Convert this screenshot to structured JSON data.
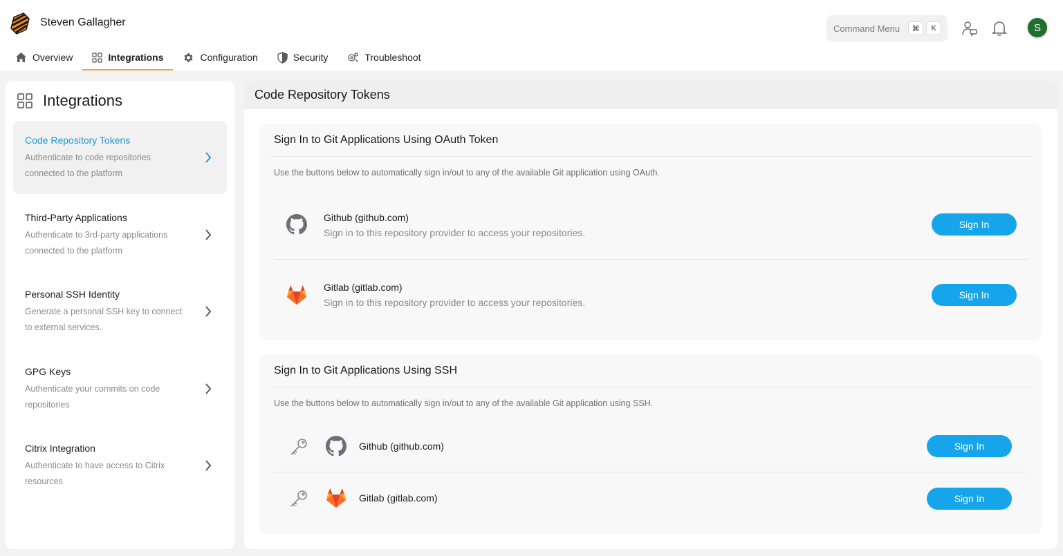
{
  "header": {
    "user_name": "Steven Gallagher",
    "command_menu": {
      "label": "Command Menu",
      "key1": "⌘",
      "key2": "K"
    },
    "avatar_initial": "S",
    "avatar_color": "#1f6f2e"
  },
  "tabs": [
    {
      "label": "Overview",
      "icon": "home-icon",
      "active": false
    },
    {
      "label": "Integrations",
      "icon": "grid-icon",
      "active": true
    },
    {
      "label": "Configuration",
      "icon": "gear-icon",
      "active": false
    },
    {
      "label": "Security",
      "icon": "shield-icon",
      "active": false
    },
    {
      "label": "Troubleshoot",
      "icon": "troubleshoot-icon",
      "active": false
    }
  ],
  "sidebar": {
    "title": "Integrations",
    "items": [
      {
        "title": "Code Repository Tokens",
        "desc": "Authenticate to code repositories connected to the platform",
        "active": true
      },
      {
        "title": "Third-Party Applications",
        "desc": "Authenticate to 3rd-party applications connected to the platform",
        "active": false
      },
      {
        "title": "Personal SSH Identity",
        "desc": "Generate a personal SSH key to connect to external services.",
        "active": false
      },
      {
        "title": "GPG Keys",
        "desc": "Authenticate your commits on code repositories",
        "active": false
      },
      {
        "title": "Citrix Integration",
        "desc": "Authenticate to have access to Citrix resources",
        "active": false
      }
    ]
  },
  "main": {
    "title": "Code Repository Tokens",
    "oauth": {
      "title": "Sign In to Git Applications Using OAuth Token",
      "desc": "Use the buttons below to automatically sign in/out to any of the available Git application using OAuth.",
      "providers": [
        {
          "name": "Github (github.com)",
          "desc": "Sign in to this repository provider to access your repositories.",
          "icon": "github-icon",
          "button": "Sign In"
        },
        {
          "name": "Gitlab (gitlab.com)",
          "desc": "Sign in to this repository provider to access your repositories.",
          "icon": "gitlab-icon",
          "button": "Sign In"
        }
      ]
    },
    "ssh": {
      "title": "Sign In to Git Applications Using SSH",
      "desc": "Use the buttons below to automatically sign in/out to any of the available Git application using SSH.",
      "providers": [
        {
          "name": "Github (github.com)",
          "icon": "github-icon",
          "button": "Sign In"
        },
        {
          "name": "Gitlab (gitlab.com)",
          "icon": "gitlab-icon",
          "button": "Sign In"
        }
      ]
    }
  },
  "colors": {
    "accent": "#16a5ea",
    "active_link": "#1f9ad6",
    "tab_underline": "#f0a43a"
  }
}
